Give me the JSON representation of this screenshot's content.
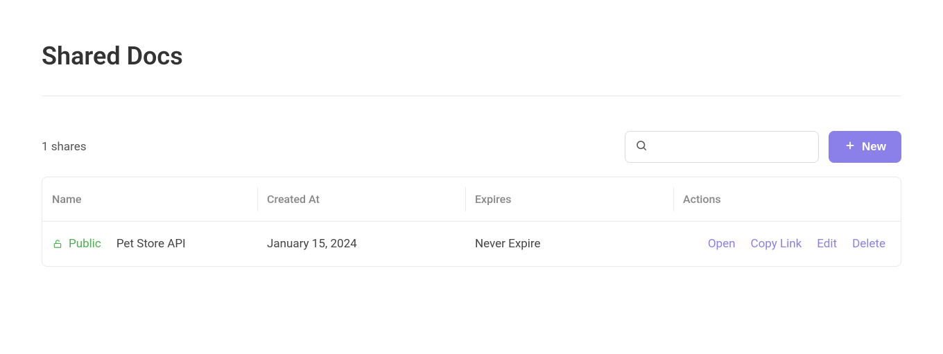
{
  "header": {
    "title": "Shared Docs"
  },
  "toolbar": {
    "shares_count": "1 shares",
    "search_placeholder": "",
    "new_label": "New"
  },
  "table": {
    "columns": {
      "name": "Name",
      "created_at": "Created At",
      "expires": "Expires",
      "actions": "Actions"
    },
    "rows": [
      {
        "visibility": "Public",
        "name": "Pet Store API",
        "created_at": "January 15, 2024",
        "expires": "Never Expire",
        "actions": {
          "open": "Open",
          "copy_link": "Copy Link",
          "edit": "Edit",
          "delete": "Delete"
        }
      }
    ]
  },
  "colors": {
    "accent": "#8b80ea",
    "public_green": "#4caf50"
  }
}
